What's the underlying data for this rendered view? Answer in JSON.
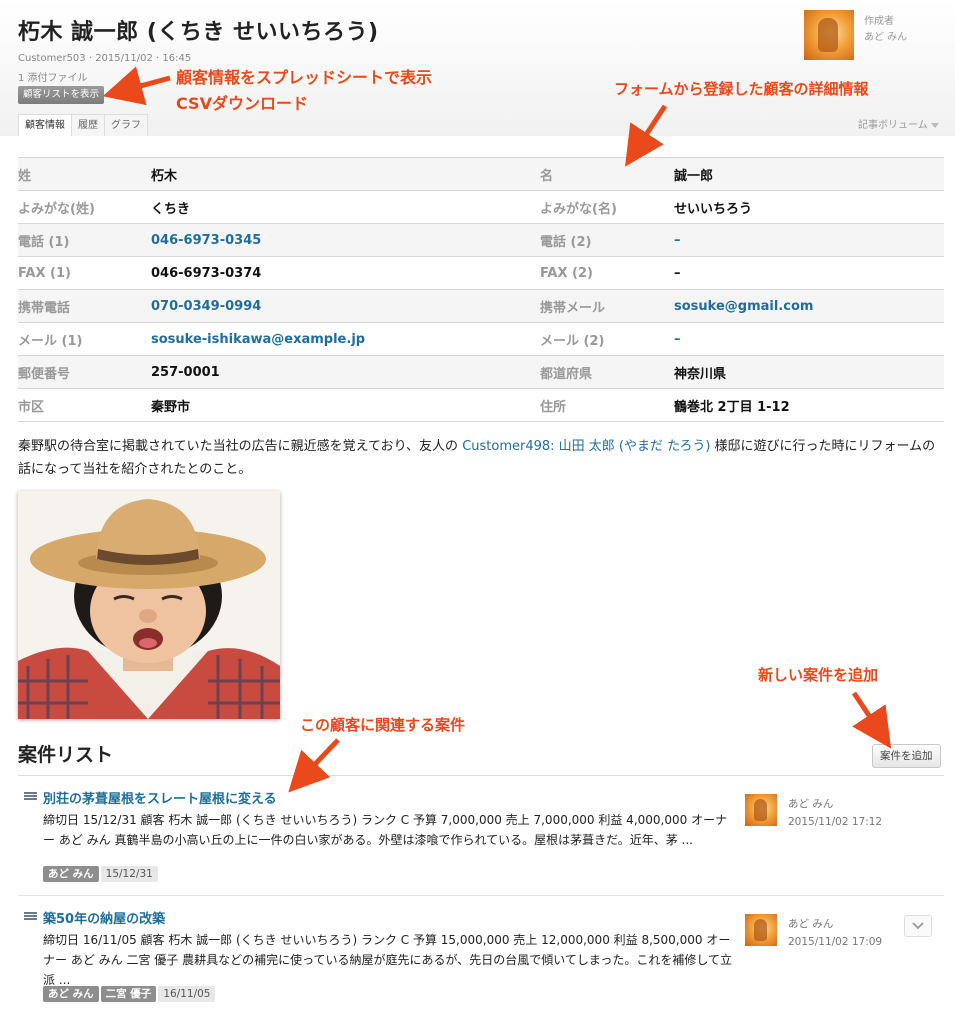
{
  "header": {
    "title": "朽木 誠一郎 (くちき せいいちろう)",
    "meta": "Customer503 · 2015/11/02 · 16:45",
    "attachments": "1 添付ファイル",
    "list_button": "顧客リストを表示",
    "author_label": "作成者",
    "author_name": "あど みん",
    "volume": "記事ボリューム"
  },
  "tabs": [
    {
      "label": "顧客情報",
      "active": true
    },
    {
      "label": "履歴",
      "active": false
    },
    {
      "label": "グラフ",
      "active": false
    }
  ],
  "fields": [
    [
      {
        "label": "姓",
        "value": "朽木"
      },
      {
        "label": "名",
        "value": "誠一郎"
      }
    ],
    [
      {
        "label": "よみがな(姓)",
        "value": "くちき"
      },
      {
        "label": "よみがな(名)",
        "value": "せいいちろう"
      }
    ],
    [
      {
        "label": "電話 (1)",
        "value": "046-6973-0345"
      },
      {
        "label": "電話 (2)",
        "value": "–"
      }
    ],
    [
      {
        "label": "FAX (1)",
        "value": "046-6973-0374"
      },
      {
        "label": "FAX (2)",
        "value": "–"
      }
    ],
    [
      {
        "label": "携帯電話",
        "value": "070-0349-0994"
      },
      {
        "label": "携帯メール",
        "value": "sosuke@gmail.com"
      }
    ],
    [
      {
        "label": "メール (1)",
        "value": "sosuke-ishikawa@example.jp"
      },
      {
        "label": "メール (2)",
        "value": "–"
      }
    ],
    [
      {
        "label": "郵便番号",
        "value": "257-0001"
      },
      {
        "label": "都道府県",
        "value": "神奈川県"
      }
    ],
    [
      {
        "label": "市区",
        "value": "秦野市"
      },
      {
        "label": "住所",
        "value": "鶴巻北 2丁目 1-12"
      }
    ]
  ],
  "description": {
    "before": "秦野駅の待合室に掲載されていた当社の広告に親近感を覚えており、友人の ",
    "link": "Customer498: 山田 太郎 (やまだ たろう)",
    "after": " 様邸に遊びに行った時にリフォームの話になって当社を紹介されたとのこと。"
  },
  "cases_section": {
    "title": "案件リスト",
    "add_button": "案件を追加"
  },
  "cases": [
    {
      "title": "別荘の茅葺屋根をスレート屋根に変える",
      "desc": "締切日 15/12/31 顧客 朽木 誠一郎 (くちき せいいちろう) ランク C 予算 7,000,000 売上 7,000,000 利益 4,000,000 オーナー あど みん 真鶴半島の小高い丘の上に一件の白い家がある。外壁は漆喰で作られている。屋根は茅葺きだ。近年、茅 ...",
      "tags": [
        "あど みん"
      ],
      "date_tag": "15/12/31",
      "author": "あど みん",
      "time": "2015/11/02 17:12"
    },
    {
      "title": "築50年の納屋の改築",
      "desc": "締切日 16/11/05 顧客 朽木 誠一郎 (くちき せいいちろう) ランク C 予算 15,000,000 売上 12,000,000 利益 8,500,000 オーナー あど みん 二宮 優子 農耕具などの補完に使っている納屋が庭先にあるが、先日の台風で傾いてしまった。これを補修して立派 ...",
      "tags": [
        "あど みん",
        "二宮 優子"
      ],
      "date_tag": "16/11/05",
      "author": "あど みん",
      "time": "2015/11/02 17:09"
    }
  ],
  "annotations": {
    "spreadsheet": "顧客情報をスプレッドシートで表示",
    "csv": "CSVダウンロード",
    "form": "フォームから登録した顧客の詳細情報",
    "related": "この顧客に関連する案件",
    "add_new": "新しい案件を追加"
  },
  "colors": {
    "link": "#1f6e9a",
    "annotation": "#ea4a1b",
    "label": "#999999"
  }
}
